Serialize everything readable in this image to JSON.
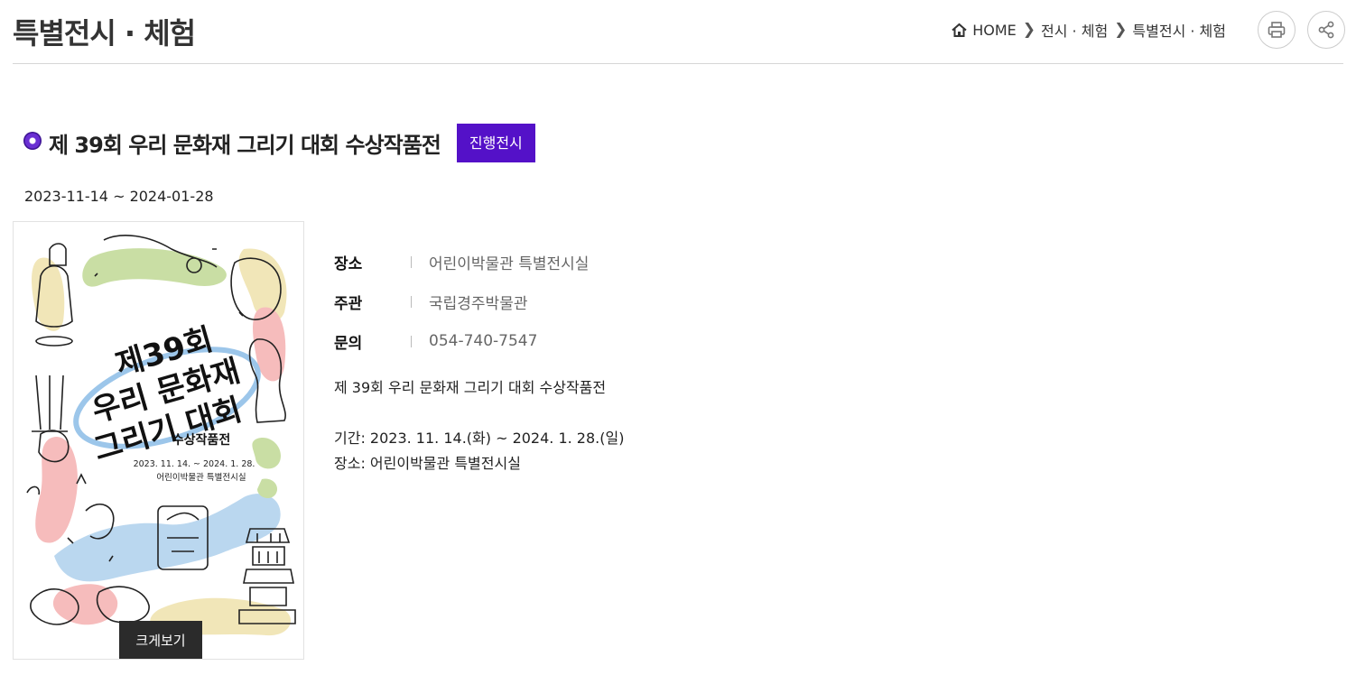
{
  "page_title": "특별전시 · 체험",
  "breadcrumb": {
    "home": "HOME",
    "level1": "전시 · 체험",
    "level2": "특별전시 · 체험"
  },
  "icons": {
    "home": "home-icon",
    "print": "printer-icon",
    "share": "share-icon",
    "title_bullet": "ring-bullet-icon"
  },
  "exhibit": {
    "title": "제 39회 우리 문화재 그리기 대회 수상작품전",
    "status": "진행전시",
    "date_range": "2023-11-14 ~ 2024-01-28",
    "zoom_label": "크게보기",
    "poster": {
      "title_lines": [
        "제39회",
        "우리 문화재",
        "그리기 대회"
      ],
      "subtitle": "수상작품전",
      "dates": "2023. 11. 14. ~ 2024. 1. 28.",
      "venue": "어린이박물관 특별전시실"
    },
    "info": [
      {
        "label": "장소",
        "value": "어린이박물관 특별전시실"
      },
      {
        "label": "주관",
        "value": "국립경주박물관"
      },
      {
        "label": "문의",
        "value": "054-740-7547"
      }
    ],
    "description": {
      "line1": "제 39회 우리 문화재 그리기 대회 수상작품전",
      "line2": "기간: 2023. 11. 14.(화) ~ 2024. 1. 28.(일)",
      "line3": "장소: 어린이박물관 특별전시실"
    }
  },
  "colors": {
    "badge": "#5411c8",
    "accent": "#6a2fd3",
    "zoom_button": "#2b2b2b"
  }
}
